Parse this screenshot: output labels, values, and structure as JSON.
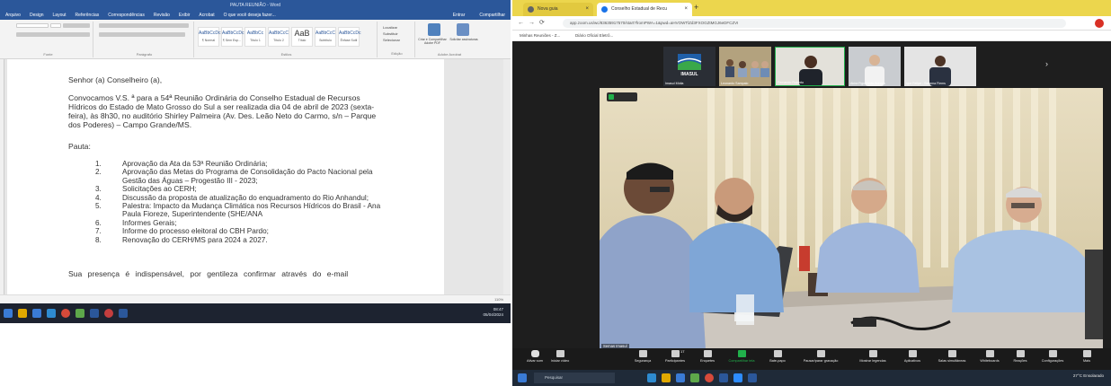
{
  "word": {
    "title": "PAUTA REUNIÃO - Word",
    "menu": [
      "Arquivo",
      "Design",
      "Layout",
      "Referências",
      "Correspondências",
      "Revisão",
      "Exibir",
      "Acrobat",
      "O que você deseja fazer..."
    ],
    "menu_right": [
      "Entrar",
      "Compartilhar"
    ],
    "ribbon_groups": [
      "Fonte",
      "Parágrafo",
      "Estilos",
      "Edição",
      "Adobe Acrobat"
    ],
    "styles": [
      {
        "sample": "AaBbCcDc",
        "name": "¶ Normal"
      },
      {
        "sample": "AaBbCcDc",
        "name": "¶ Sem Esp..."
      },
      {
        "sample": "AaBbCc",
        "name": "Título 1"
      },
      {
        "sample": "AaBbCcC",
        "name": "Título 2"
      },
      {
        "sample": "AaB",
        "name": "Título"
      },
      {
        "sample": "AaBbCcC",
        "name": "Subtítulo"
      },
      {
        "sample": "AaBbCcDc",
        "name": "Ênfase Sutil"
      }
    ],
    "edit_items": [
      "Localizar",
      "Substituir",
      "Selecionar"
    ],
    "acrobat_items": [
      "Criar e Compartilhar Adobe PDF",
      "Solicitar assinaturas"
    ],
    "document": {
      "salutation": "Senhor (a) Conselheiro (a),",
      "intro": "Convocamos V.S. ª para a 54ª Reunião Ordinária do Conselho Estadual de Recursos Hídricos do Estado de Mato Grosso do Sul a ser realizada dia 04 de abril de 2023 (sexta-feira), às 8h30, no auditório Shirley Palmeira (Av. Des. Leão Neto do Carmo, s/n – Parque dos Poderes) – Campo Grande/MS.",
      "pauta_label": "Pauta:",
      "pauta": [
        {
          "n": "1.",
          "t": "Aprovação da Ata da 53ª Reunião Ordinária;"
        },
        {
          "n": "2.",
          "t": "Aprovação das Metas do Programa de Consolidação do Pacto Nacional pela Gestão das Águas – Progestão III - 2023;"
        },
        {
          "n": "3.",
          "t": "Solicitações ao CERH;"
        },
        {
          "n": "4.",
          "t": "Discussão da proposta de atualização do enquadramento do Rio Anhandul;"
        },
        {
          "n": "5.",
          "t": "Palestra: Impacto da Mudança Climática nos Recursos Hídricos do Brasil - Ana Paula Fioreze, Superintendente (SHE/ANA"
        },
        {
          "n": "6.",
          "t": "Informes Gerais;"
        },
        {
          "n": "7.",
          "t": "Informe do processo eleitoral do CBH Pardo;"
        },
        {
          "n": "8.",
          "t": "Renovação do CERH/MS para 2024 a 2027."
        }
      ],
      "closing": "Sua presença é indispensável, por gentileza confirmar através do e-mail"
    },
    "zoom_level": "110%",
    "clock": {
      "time": "08:47",
      "date": "05/04/2024"
    }
  },
  "browser": {
    "tabs": [
      {
        "label": "Nova guia",
        "color": "#5f6368"
      },
      {
        "label": "Conselho Estadual de Recu",
        "color": "#1a73e8"
      }
    ],
    "url": "app.zoom.us/wc/83635917570/start?fromPWA=1&pwd=aHVOWTlZd3FXOGZtMGJ6eDFCZVI",
    "bookmarks": [
      "Minhas Reuniões - Z...",
      "Diário Oficial Eletrô..."
    ],
    "gallery": [
      {
        "name": "Imasul Mídia"
      },
      {
        "name": "Leonardo Sampaio"
      },
      {
        "name": "Fernando Roberto"
      },
      {
        "name": "Akira Figueiredo Bungra"
      },
      {
        "name": "Igor Felipe - Sistema Fiems"
      }
    ],
    "logo_text": "IMASUL",
    "main_video_name": "Semas Imasul",
    "toolbar": [
      "Ativar som",
      "Iniciar vídeo",
      "Segurança",
      "Participantes",
      "Enquetes",
      "Compartilhar tela",
      "Bate-papo",
      "Pausar/parar gravação",
      "Mostrar legendas",
      "Aplicativos",
      "Salas simultâneas",
      "Whiteboards",
      "Reações",
      "Configurações",
      "Mais"
    ],
    "participants_count": "17",
    "taskbar_search": "Pesquisar",
    "weather": "27°C  Ensolarado"
  },
  "colors": {
    "word_blue": "#2b579a",
    "browser_tab_bar": "#ecd64d",
    "zoom_green": "#21b04b"
  }
}
